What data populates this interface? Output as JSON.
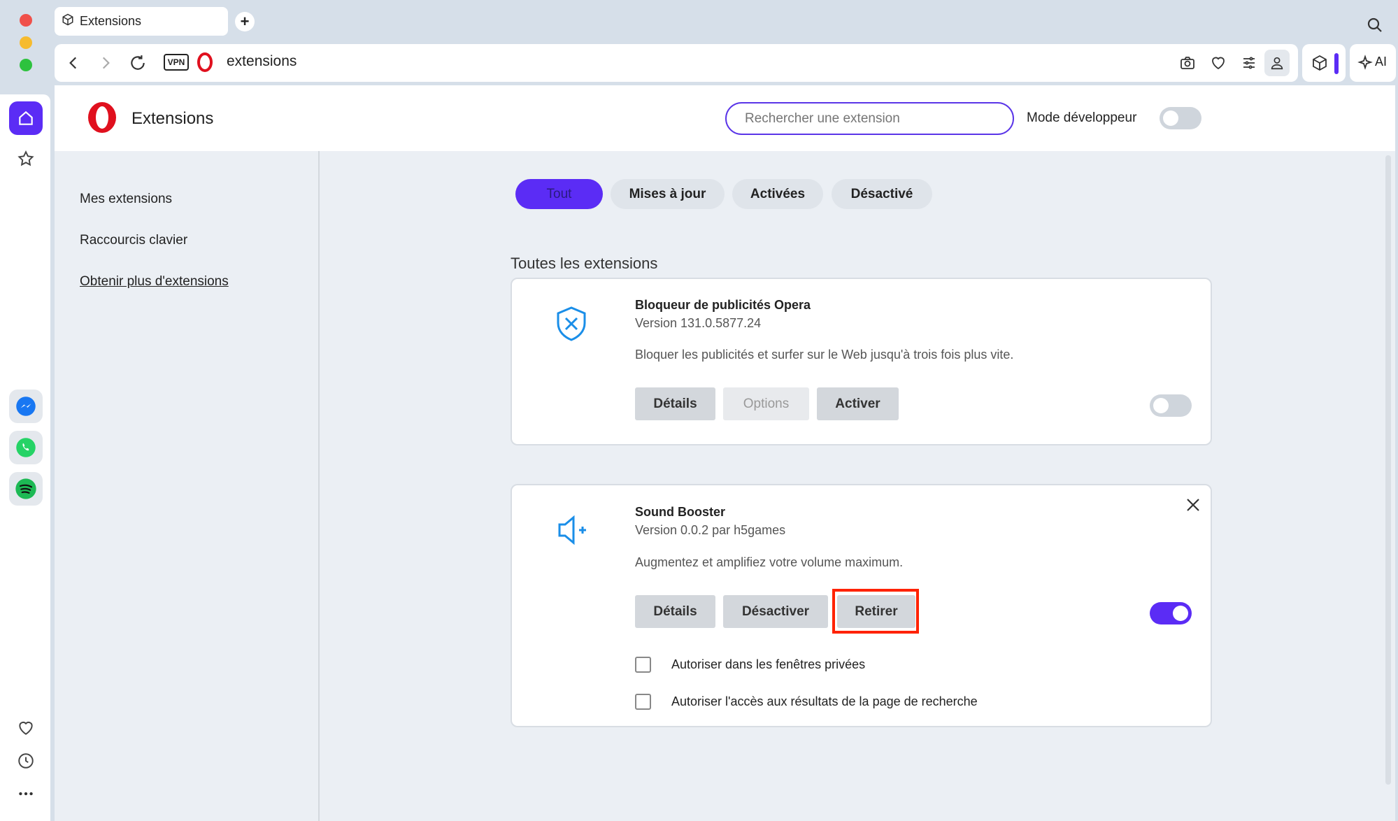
{
  "window": {
    "tab_title": "Extensions",
    "new_tab_label": "+"
  },
  "toolbar": {
    "vpn_label": "VPN",
    "address": "extensions",
    "ai_label": "AI"
  },
  "header": {
    "title": "Extensions",
    "search_placeholder": "Rechercher une extension",
    "dev_mode_label": "Mode développeur",
    "dev_mode_on": false
  },
  "sidebar": {
    "items": [
      {
        "label": "Mes extensions"
      },
      {
        "label": "Raccourcis clavier"
      },
      {
        "label": "Obtenir plus d'extensions"
      }
    ]
  },
  "filters": [
    {
      "label": "Tout",
      "active": true
    },
    {
      "label": "Mises à jour",
      "active": false
    },
    {
      "label": "Activées",
      "active": false
    },
    {
      "label": "Désactivé",
      "active": false
    }
  ],
  "section_title": "Toutes les extensions",
  "extensions": [
    {
      "icon": "shield-x-icon",
      "name": "Bloqueur de publicités Opera",
      "version": "Version 131.0.5877.24",
      "description": "Bloquer les publicités et surfer sur le Web jusqu'à trois fois plus vite.",
      "buttons": [
        "Détails",
        "Options",
        "Activer"
      ],
      "enabled": false
    },
    {
      "icon": "speaker-plus-icon",
      "name": "Sound Booster",
      "version": "Version 0.0.2 par h5games",
      "description": "Augmentez et amplifiez votre volume maximum.",
      "buttons": [
        "Détails",
        "Désactiver",
        "Retirer"
      ],
      "enabled": true,
      "options": [
        {
          "label": "Autoriser dans les fenêtres privées",
          "checked": false
        },
        {
          "label": "Autoriser l'accès aux résultats de la page de recherche",
          "checked": false
        }
      ]
    }
  ],
  "colors": {
    "accent": "#5b2cf5",
    "highlight": "#ff2200",
    "opera_red": "#e0101e"
  }
}
